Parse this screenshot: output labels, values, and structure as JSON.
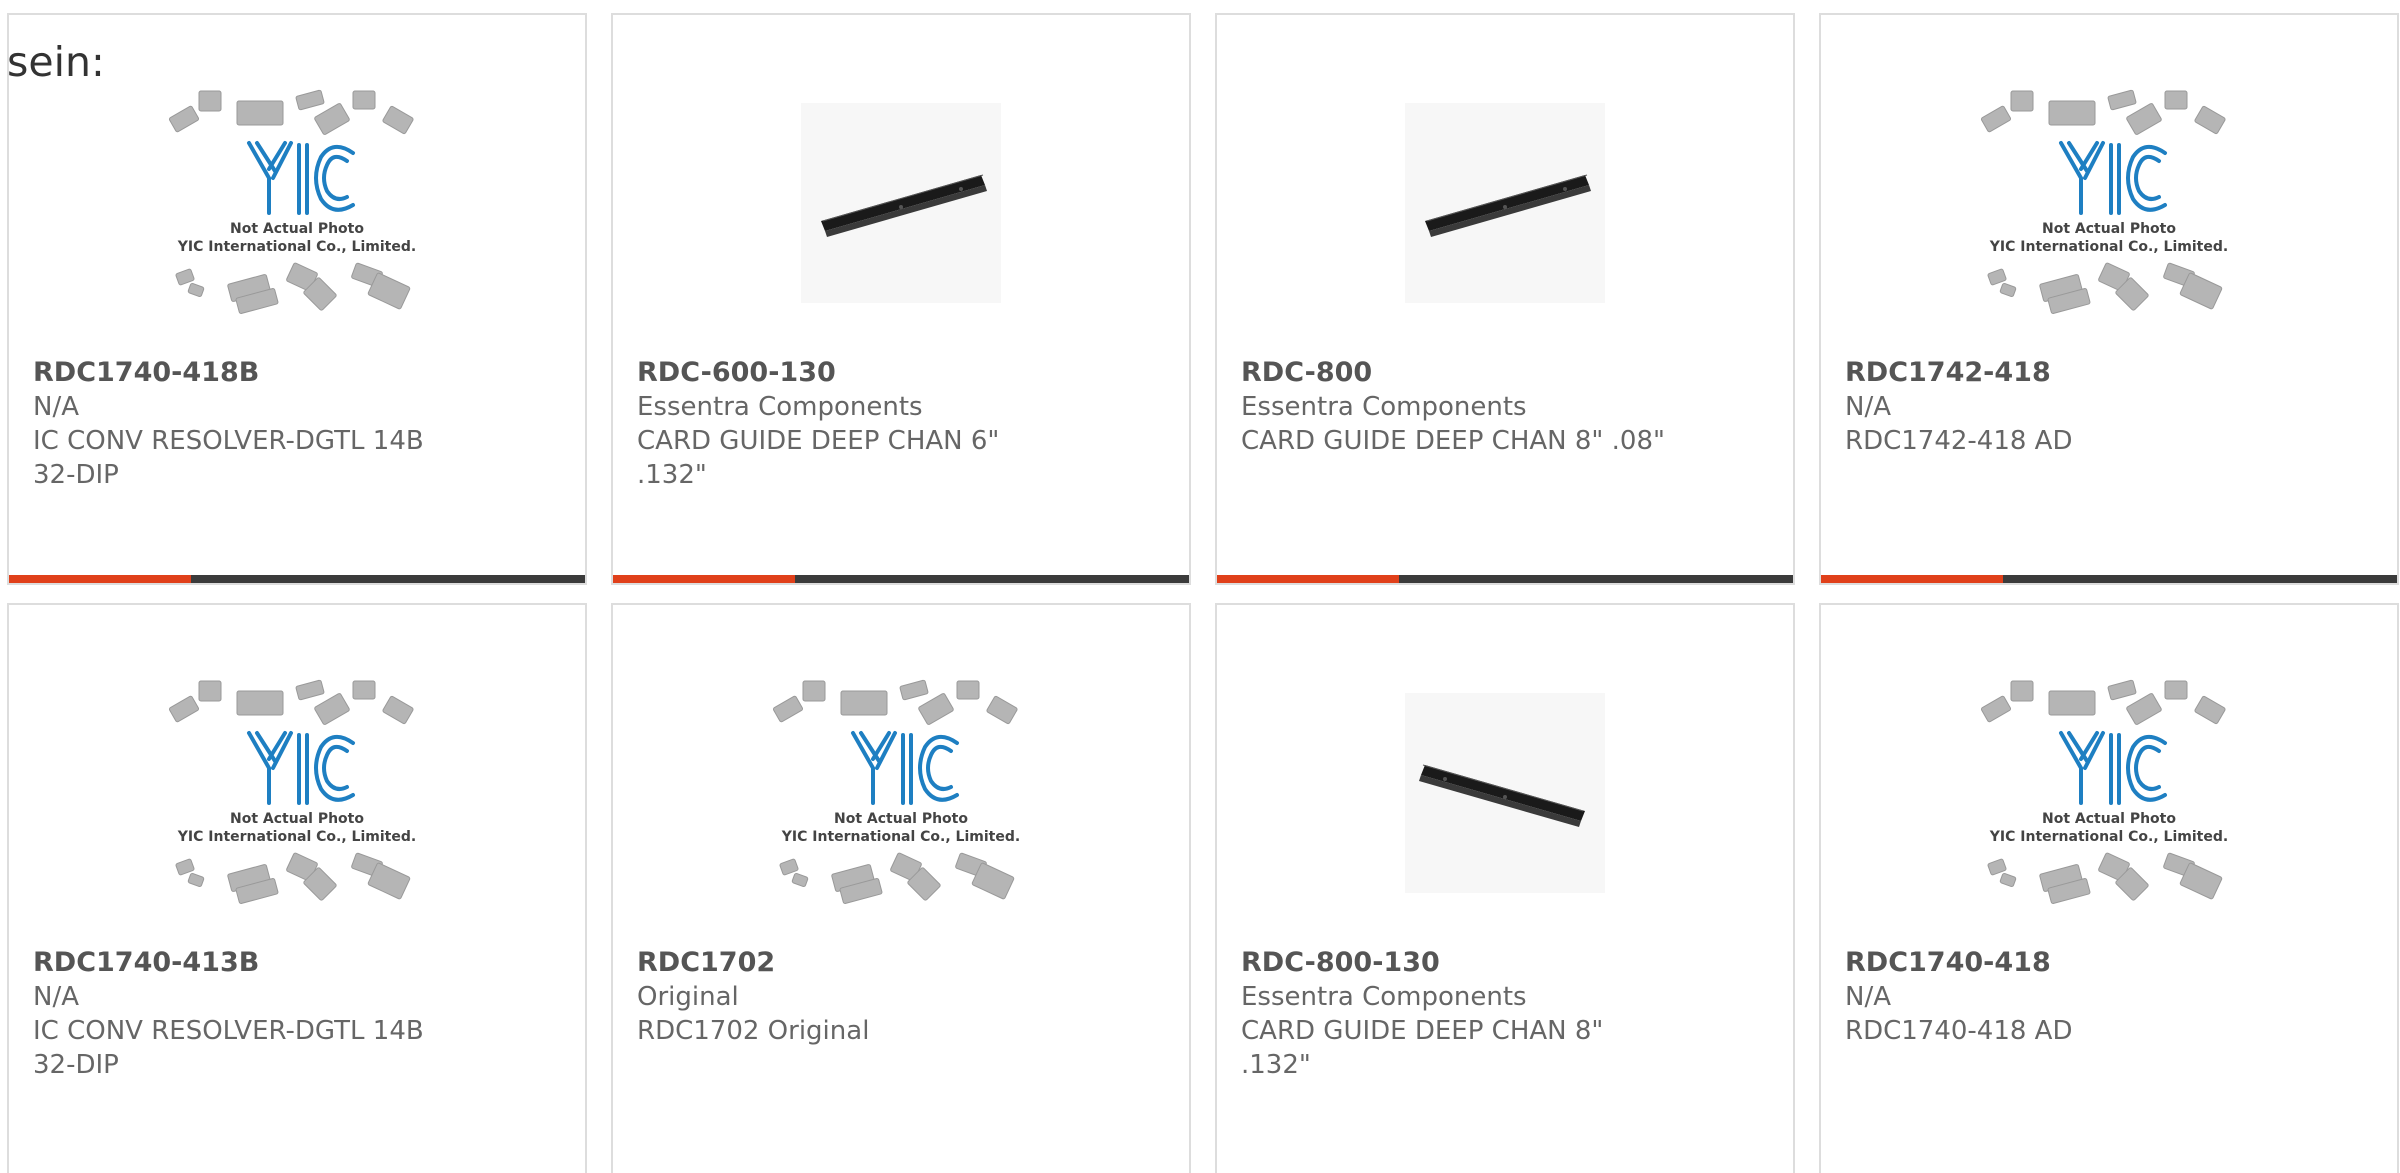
{
  "lead_text": "sein:",
  "colors": {
    "accent": "#e0401a",
    "bar": "#3b3b3b",
    "yic_blue": "#1e7fc2"
  },
  "placeholder": {
    "line1": "Not Actual Photo",
    "line2": "YIC International Co., Limited.",
    "logo": "YIC"
  },
  "products": [
    {
      "part": "RDC1740-418B",
      "maker": "N/A",
      "desc": "IC CONV RESOLVER-DGTL 14B\n32-DIP",
      "image": "yic-placeholder"
    },
    {
      "part": "RDC-600-130",
      "maker": "Essentra Components",
      "desc": "CARD GUIDE DEEP CHAN 6\"\n.132\"",
      "image": "card-guide-rail"
    },
    {
      "part": "RDC-800",
      "maker": "Essentra Components",
      "desc": "CARD GUIDE DEEP CHAN 8\" .08\"",
      "image": "card-guide-rail"
    },
    {
      "part": "RDC1742-418",
      "maker": "N/A",
      "desc": "RDC1742-418 AD",
      "image": "yic-placeholder"
    },
    {
      "part": "RDC1740-413B",
      "maker": "N/A",
      "desc": "IC CONV RESOLVER-DGTL 14B\n32-DIP",
      "image": "yic-placeholder"
    },
    {
      "part": "RDC1702",
      "maker": "Original",
      "desc": "RDC1702 Original",
      "image": "yic-placeholder"
    },
    {
      "part": "RDC-800-130",
      "maker": "Essentra Components",
      "desc": "CARD GUIDE DEEP CHAN 8\"\n.132\"",
      "image": "card-guide-rail"
    },
    {
      "part": "RDC1740-418",
      "maker": "N/A",
      "desc": "RDC1740-418 AD",
      "image": "yic-placeholder"
    }
  ]
}
